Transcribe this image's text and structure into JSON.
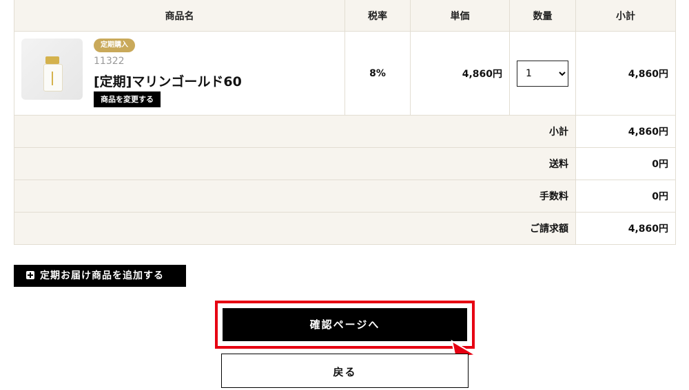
{
  "table": {
    "headers": {
      "name": "商品名",
      "tax": "税率",
      "price": "単価",
      "qty": "数量",
      "subtotal": "小計"
    },
    "item": {
      "badge": "定期購入",
      "code": "11322",
      "name": "[定期]マリンゴールド60",
      "change_label": "商品を変更する",
      "tax": "8%",
      "price": "4,860円",
      "qty": "1",
      "subtotal": "4,860円"
    },
    "summary": [
      {
        "label": "小計",
        "value": "4,860円"
      },
      {
        "label": "送料",
        "value": "0円"
      },
      {
        "label": "手数料",
        "value": "0円"
      },
      {
        "label": "ご請求額",
        "value": "4,860円"
      }
    ]
  },
  "actions": {
    "add_label": "定期お届け商品を追加する",
    "confirm_label": "確認ページへ",
    "back_label": "戻る"
  },
  "colors": {
    "highlight": "#e60012",
    "badge": "#c9a95a",
    "table_bg": "#f7f4ee"
  },
  "icons": [
    "plus-icon",
    "cursor-arrow-icon"
  ]
}
